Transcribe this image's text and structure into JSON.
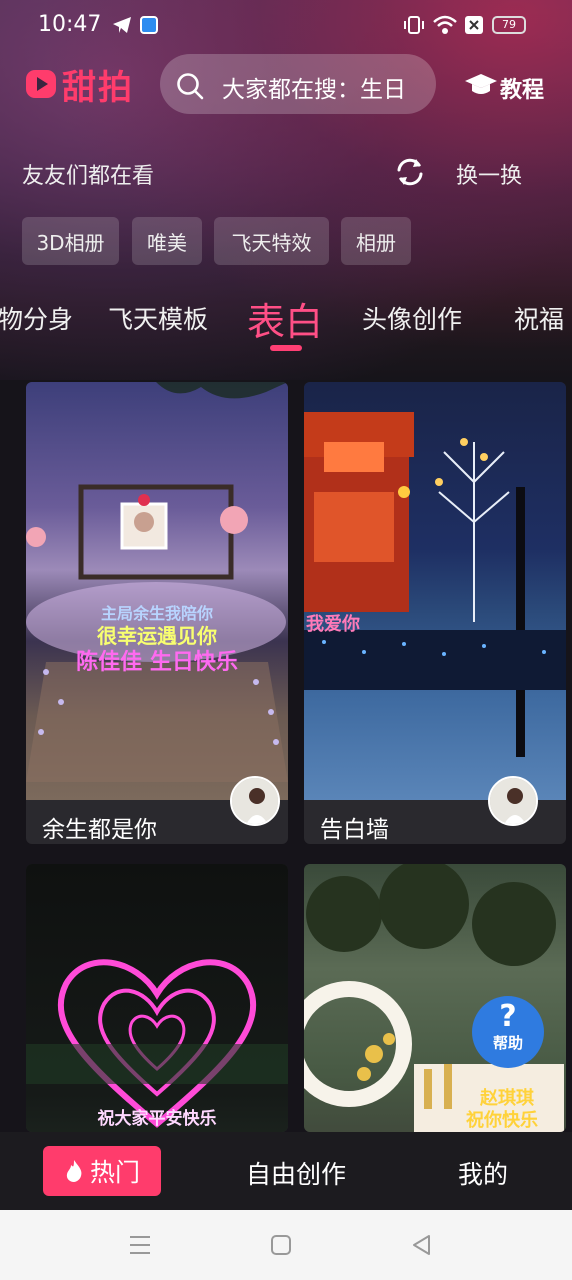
{
  "status_bar": {
    "time": "10:47",
    "battery": "79"
  },
  "header": {
    "logo_text": "甜拍",
    "search_placeholder": "大家都在搜：生日",
    "tutorial_label": "教程"
  },
  "trending": {
    "title": "友友们都在看",
    "refresh_label": "换一换",
    "chips": [
      "3D相册",
      "唯美",
      "飞天特效",
      "相册"
    ]
  },
  "categories": [
    "物分身",
    "飞天模板",
    "表白",
    "头像创作",
    "祝福"
  ],
  "active_category": "表白",
  "cards": [
    {
      "title": "余生都是你",
      "overlay_lines": [
        "主局余生我陪你",
        "很幸运遇见你",
        "陈佳佳 生日快乐"
      ]
    },
    {
      "title": "告白墙",
      "overlay_lines": [
        "我爱你"
      ]
    },
    {
      "title": "",
      "overlay_lines": [
        "祝大家平安快乐"
      ]
    },
    {
      "title": "",
      "overlay_lines": [
        "赵琪琪",
        "祝你快乐"
      ]
    }
  ],
  "help_label": "帮助",
  "bottom_nav": {
    "hot": "热门",
    "create": "自由创作",
    "mine": "我的"
  },
  "colors": {
    "accent": "#ff3c6c",
    "help_blue": "#2f7be0"
  }
}
